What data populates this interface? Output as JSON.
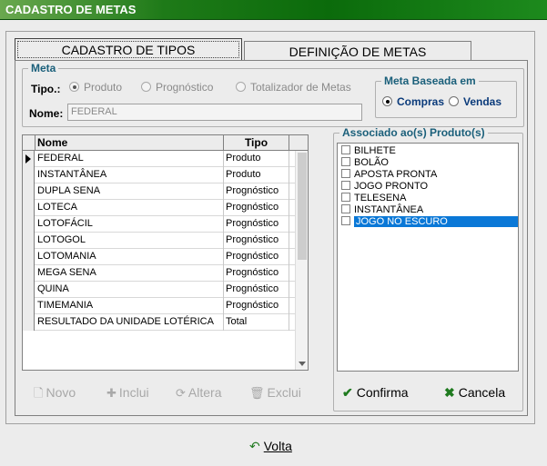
{
  "window": {
    "title": "CADASTRO DE METAS"
  },
  "tabs": [
    {
      "label": "CADASTRO DE TIPOS",
      "active": true
    },
    {
      "label": "DEFINIÇÃO DE METAS",
      "active": false
    }
  ],
  "meta": {
    "legend": "Meta",
    "tipo_label": "Tipo.:",
    "tipo_options": [
      "Produto",
      "Prognóstico",
      "Totalizador de Metas"
    ],
    "tipo_selected": "Produto",
    "nome_label": "Nome:",
    "nome_value": "FEDERAL"
  },
  "meta_baseada": {
    "legend": "Meta Baseada em",
    "options": [
      "Compras",
      "Vendas"
    ],
    "selected": "Compras"
  },
  "grid": {
    "headers": [
      "Nome",
      "Tipo"
    ],
    "rows": [
      [
        "FEDERAL",
        "Produto"
      ],
      [
        "INSTANTÂNEA",
        "Produto"
      ],
      [
        "DUPLA SENA",
        "Prognóstico"
      ],
      [
        "LOTECA",
        "Prognóstico"
      ],
      [
        "LOTOFÁCIL",
        "Prognóstico"
      ],
      [
        "LOTOGOL",
        "Prognóstico"
      ],
      [
        "LOTOMANIA",
        "Prognóstico"
      ],
      [
        "MEGA SENA",
        "Prognóstico"
      ],
      [
        "QUINA",
        "Prognóstico"
      ],
      [
        "TIMEMANIA",
        "Prognóstico"
      ],
      [
        "RESULTADO DA UNIDADE LOTÉRICA",
        "Total"
      ]
    ],
    "current_row": 0
  },
  "actions": {
    "novo": "Novo",
    "inclui": "Inclui",
    "altera": "Altera",
    "exclui": "Exclui"
  },
  "associado": {
    "legend": "Associado ao(s) Produto(s)",
    "items": [
      "BILHETE",
      "BOLÃO",
      "APOSTA PRONTA",
      "JOGO PRONTO",
      "TELESENA",
      "INSTANTÂNEA",
      "JOGO NO ESCURO"
    ],
    "selected_index": 6,
    "confirma": "Confirma",
    "cancela": "Cancela"
  },
  "footer": {
    "volta": "Volta"
  },
  "colors": {
    "title_green": "#0b6b0b",
    "legend_blue": "#1a5f7a",
    "selection": "#0a78d7"
  }
}
